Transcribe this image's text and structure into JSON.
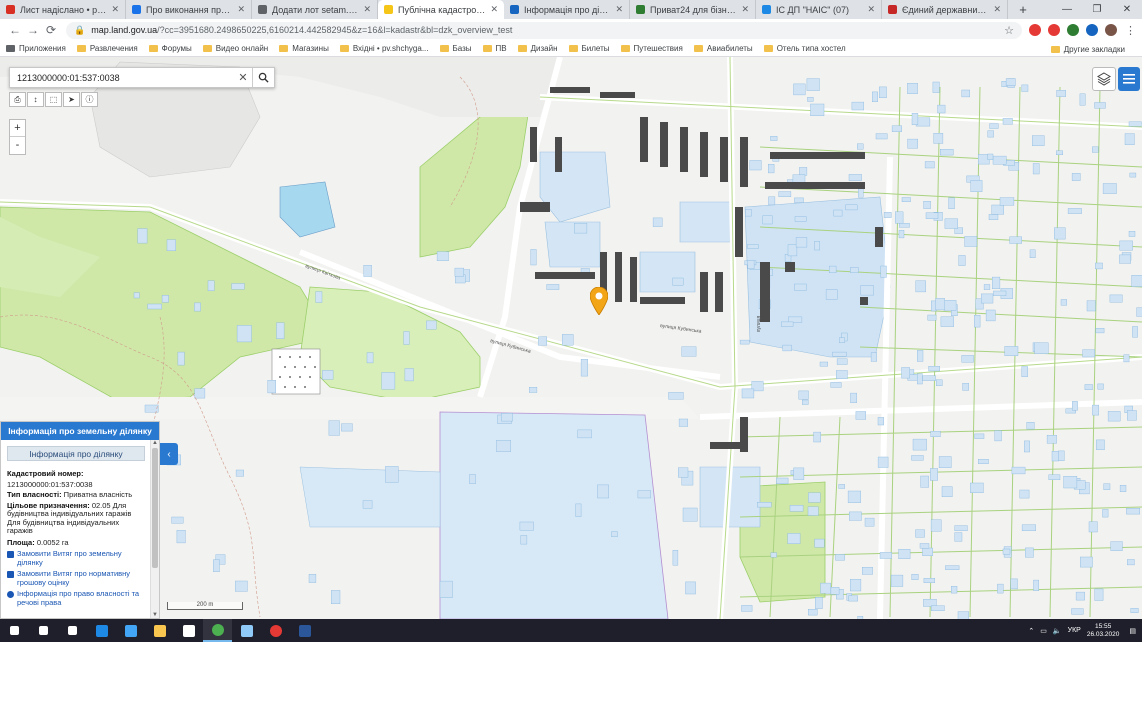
{
  "browser": {
    "tabs": [
      {
        "label": "Лист надіслано • pv.shchyg...",
        "color": "#d93025",
        "active": false
      },
      {
        "label": "Про виконання провадження",
        "color": "#1a73e8",
        "active": false
      },
      {
        "label": "Додати лот  setam.net.ua",
        "color": "#5f6368",
        "active": false
      },
      {
        "label": "Публічна кадастрова карта",
        "color": "#f5c518",
        "active": true
      },
      {
        "label": "Інформація про ділянку",
        "color": "#1565c0",
        "active": false
      },
      {
        "label": "Приват24 для бізнесу",
        "color": "#2e7d32",
        "active": false
      },
      {
        "label": "ІС ДП \"НАІС\" (07)",
        "color": "#1e88e5",
        "active": false
      },
      {
        "label": "Єдиний державний реєстр",
        "color": "#c62828",
        "active": false
      }
    ],
    "new_tab": "+",
    "window_controls": {
      "minimize": "—",
      "maximize": "❐",
      "close": "✕"
    },
    "nav": {
      "back": "←",
      "forward": "→",
      "reload": "⟳"
    },
    "address": {
      "host": "map.land.gov.ua",
      "path": "/?cc=3951680.2498650225,6160214.442582945&z=16&l=kadastr&bl=dzk_overview_test"
    },
    "bookmarks": [
      "Приложения",
      "Развлечения",
      "Форумы",
      "Видео онлайн",
      "Магазины",
      "Вхідні • pv.shchyga...",
      "Базы",
      "ПВ",
      "Дизайн",
      "Билеты",
      "Путешествия",
      "Авиабилеты",
      "Отель типа хостел"
    ],
    "bookmarks_other": "Другие закладки",
    "extension_colors": [
      "#e53935",
      "#e53935",
      "#2e7d32",
      "#1565c0",
      "#795548"
    ]
  },
  "map": {
    "search": {
      "value": "1213000000:01:537:0038",
      "clear": "✕"
    },
    "tools": [
      "print-icon",
      "measure-length-icon",
      "measure-area-icon",
      "pointer-icon",
      "info-icon"
    ],
    "zoom_in": "+",
    "zoom_out": "-",
    "scale_label": "200 m",
    "collapse": "‹"
  },
  "panel": {
    "header": "Інформація про земельну ділянку",
    "subheader": "Інформація про ділянку",
    "cadastral_label": "Кадастровий номер:",
    "cadastral_value": "1213000000:01:537:0038",
    "ownership_label": "Тип власності:",
    "ownership_value": "Приватна власність",
    "purpose_label": "Цільове призначення:",
    "purpose_value": "02.05 Для будівництва індивідуальних гаражів Для будівництва індивідуальних гаражів",
    "area_label": "Площа:",
    "area_value": "0.0052 га",
    "links": [
      "Замовити Витяг про земельну ділянку",
      "Замовити Витяг про нормативну грошову оцінку",
      "Інформація про право власності та речові права"
    ]
  },
  "taskbar": {
    "apps": [
      {
        "name": "start-icon",
        "color": "#ffffff"
      },
      {
        "name": "search-icon",
        "color": "#ffffff"
      },
      {
        "name": "task-view-icon",
        "color": "#ffffff"
      },
      {
        "name": "edge-icon",
        "color": "#1e88e5"
      },
      {
        "name": "mail-icon",
        "color": "#42a5f5"
      },
      {
        "name": "explorer-icon",
        "color": "#f9c74f"
      },
      {
        "name": "store-icon",
        "color": "#ffffff"
      },
      {
        "name": "chrome-icon",
        "color": "#4caf50"
      },
      {
        "name": "pen-app-icon",
        "color": "#90caf9"
      },
      {
        "name": "opera-icon",
        "color": "#e53935"
      },
      {
        "name": "word-icon",
        "color": "#2b579a"
      }
    ],
    "tray": {
      "lang": "УКР",
      "time": "15:55",
      "date": "26.03.2020"
    }
  }
}
